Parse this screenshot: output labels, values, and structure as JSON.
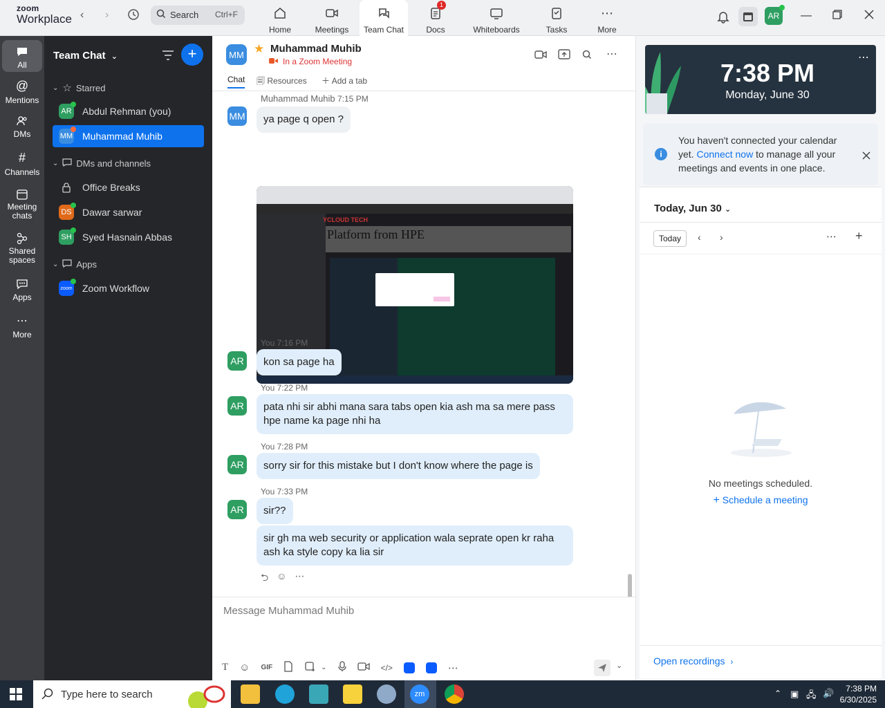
{
  "app": {
    "logo_line1": "zoom",
    "logo_line2": "Workplace"
  },
  "topbar": {
    "search_label": "Search",
    "search_shortcut": "Ctrl+F",
    "tabs": [
      {
        "label": "Home",
        "icon": "home-icon"
      },
      {
        "label": "Meetings",
        "icon": "video-icon"
      },
      {
        "label": "Team Chat",
        "icon": "chat-icon"
      },
      {
        "label": "Docs",
        "icon": "docs-icon",
        "badge": "1"
      },
      {
        "label": "Whiteboards",
        "icon": "whiteboard-icon"
      },
      {
        "label": "Tasks",
        "icon": "tasks-icon"
      },
      {
        "label": "More",
        "icon": "more-icon"
      }
    ],
    "user_initials": "AR"
  },
  "sidebar": {
    "items": [
      {
        "label": "All",
        "icon": "chat-bubble-icon"
      },
      {
        "label": "Mentions",
        "icon": "at-icon"
      },
      {
        "label": "DMs",
        "icon": "people-icon"
      },
      {
        "label": "Channels",
        "icon": "hash-icon"
      },
      {
        "label": "Meeting chats",
        "icon": "calendar-icon"
      },
      {
        "label": "Shared spaces",
        "icon": "shared-icon"
      },
      {
        "label": "Apps",
        "icon": "apps-icon"
      },
      {
        "label": "More",
        "icon": "more-icon"
      }
    ]
  },
  "chatlist": {
    "title": "Team Chat",
    "sections": {
      "starred": "Starred",
      "dms": "DMs and channels",
      "apps": "Apps"
    },
    "items": [
      {
        "name": "Abdul Rehman (you)",
        "initials": "AR",
        "color": "#2e9e61"
      },
      {
        "name": "Muhammad Muhib",
        "initials": "MM",
        "color": "#3a8de0"
      },
      {
        "name": "Office Breaks",
        "initials": "",
        "color": ""
      },
      {
        "name": "Dawar sarwar",
        "initials": "DS",
        "color": "#e06a1a"
      },
      {
        "name": "Syed Hasnain Abbas",
        "initials": "SH",
        "color": "#2e9e61"
      },
      {
        "name": "Zoom Workflow",
        "initials": "zoom",
        "color": "#0b5cff"
      }
    ]
  },
  "chat": {
    "header": {
      "initials": "MM",
      "name": "Muhammad Muhib",
      "status": "In a Zoom Meeting"
    },
    "tabs": {
      "chat": "Chat",
      "resources": "Resources",
      "add": "Add a tab"
    },
    "messages": [
      {
        "author": "Muhammad Muhib",
        "time": "7:15 PM",
        "text": "ya page q open ?"
      },
      {
        "author": "You",
        "time": "7:16 PM",
        "text": "kon sa page ha"
      },
      {
        "author": "You",
        "time": "7:22 PM",
        "text": "pata nhi sir abhi mana sara tabs open kia ash ma sa mere pass hpe name ka page nhi ha"
      },
      {
        "author": "You",
        "time": "7:28 PM",
        "text": "sorry sir for this mistake but I don't know where the page is"
      },
      {
        "author": "You",
        "time": "7:33 PM",
        "text": "sir??"
      },
      {
        "author": "",
        "time": "",
        "text": "sir gh ma web security or application wala seprate open kr raha ash ka style copy ka lia sir"
      }
    ],
    "screenshot": {
      "brand": "YCLOUD TECH",
      "headline": "Platform from HPE"
    },
    "input_placeholder": "Message Muhammad Muhib"
  },
  "calendar": {
    "time": "7:38 PM",
    "date": "Monday, June 30",
    "notice_pre": "You haven't connected your calendar yet.",
    "notice_link": "Connect now",
    "notice_post": "to manage all your meetings and events in one place.",
    "today_header": "Today, Jun 30",
    "today_button": "Today",
    "empty_text": "No meetings scheduled.",
    "schedule_link": "Schedule a meeting",
    "open_recordings": "Open recordings"
  },
  "taskbar": {
    "search_placeholder": "Type here to search",
    "time": "7:38 PM",
    "date": "6/30/2025"
  }
}
